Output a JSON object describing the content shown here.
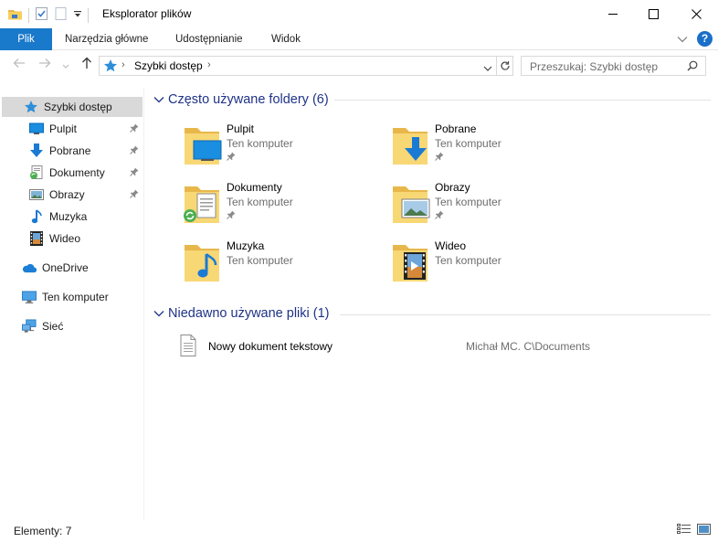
{
  "window": {
    "title": "Eksplorator plików",
    "minimize_icon": "minimize-icon",
    "maximize_icon": "maximize-icon",
    "close_icon": "close-icon"
  },
  "quick_access_toolbar": {
    "icons": [
      "folder-icon",
      "properties-checkmark-icon",
      "new-document-icon",
      "customize-dropdown-icon"
    ]
  },
  "ribbon": {
    "tabs": [
      "Plik",
      "Narzędzia główne",
      "Udostępnianie",
      "Widok"
    ],
    "active_tab": "Plik",
    "accent_color": "#1979ca"
  },
  "address": {
    "path": "Szybki dostęp",
    "search_placeholder": "Przeszukaj: Szybki dostęp"
  },
  "sidebar": {
    "items": [
      {
        "label": "Szybki dostęp",
        "icon": "star-icon",
        "selected": true,
        "pinned": false
      },
      {
        "label": "Pulpit",
        "icon": "desktop-icon",
        "pinned": true
      },
      {
        "label": "Pobrane",
        "icon": "download-arrow-icon",
        "pinned": true
      },
      {
        "label": "Dokumenty",
        "icon": "documents-icon",
        "pinned": true
      },
      {
        "label": "Obrazy",
        "icon": "pictures-icon",
        "pinned": true
      },
      {
        "label": "Muzyka",
        "icon": "music-note-icon",
        "pinned": false
      },
      {
        "label": "Wideo",
        "icon": "film-icon",
        "pinned": false
      },
      {
        "label": "OneDrive",
        "icon": "cloud-icon",
        "pinned": false
      },
      {
        "label": "Ten komputer",
        "icon": "computer-icon",
        "pinned": false
      },
      {
        "label": "Sieć",
        "icon": "network-icon",
        "pinned": false
      }
    ]
  },
  "frequent_folders": {
    "header": "Często używane foldery (6)",
    "items": [
      {
        "name": "Pulpit",
        "location": "Ten komputer",
        "pinned": true,
        "icon": "desktop-folder-icon"
      },
      {
        "name": "Pobrane",
        "location": "Ten komputer",
        "pinned": true,
        "icon": "downloads-folder-icon"
      },
      {
        "name": "Dokumenty",
        "location": "Ten komputer",
        "pinned": true,
        "icon": "documents-folder-icon"
      },
      {
        "name": "Obrazy",
        "location": "Ten komputer",
        "pinned": true,
        "icon": "pictures-folder-icon"
      },
      {
        "name": "Muzyka",
        "location": "Ten komputer",
        "pinned": false,
        "icon": "music-folder-icon"
      },
      {
        "name": "Wideo",
        "location": "Ten komputer",
        "pinned": false,
        "icon": "videos-folder-icon"
      }
    ]
  },
  "recent_files": {
    "header": "Niedawno używane pliki (1)",
    "items": [
      {
        "name": "Nowy dokument tekstowy",
        "path": "Michał MC. C\\Documents",
        "icon": "text-document-icon"
      }
    ]
  },
  "status_bar": {
    "items_count": "Elementy: 7",
    "view_icons": [
      "details-view-icon",
      "large-icons-view-icon"
    ]
  }
}
